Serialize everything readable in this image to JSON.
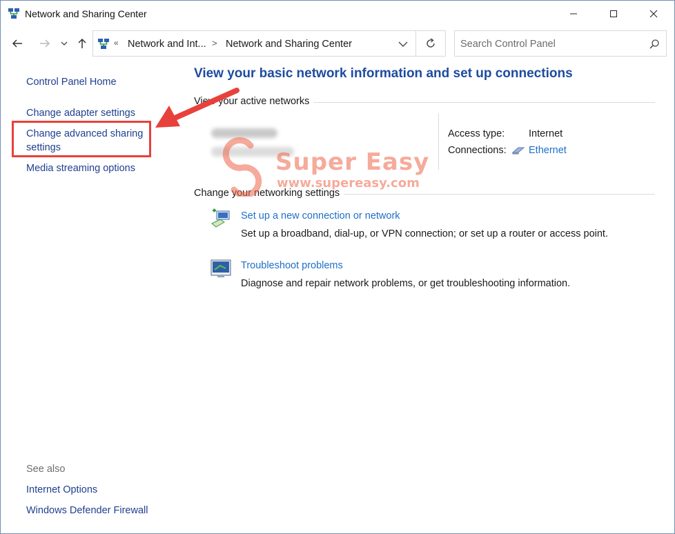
{
  "window": {
    "title": "Network and Sharing Center",
    "controls": {
      "minimize": "minimize",
      "maximize": "maximize",
      "close": "close"
    }
  },
  "navbar": {
    "back_icon": "arrow-left-icon",
    "forward_icon": "arrow-right-icon",
    "recent_icon": "chevron-down-icon",
    "up_icon": "arrow-up-icon",
    "breadcrumb": {
      "overflow": "«",
      "items": [
        "Network and Int...",
        "Network and Sharing Center"
      ],
      "separator": ">"
    },
    "refresh_icon": "refresh-icon",
    "search": {
      "placeholder": "Search Control Panel",
      "value": ""
    }
  },
  "sidebar": {
    "home": "Control Panel Home",
    "links": [
      "Change adapter settings",
      "Change advanced sharing settings",
      "Media streaming options"
    ],
    "see_also_label": "See also",
    "see_also": [
      "Internet Options",
      "Windows Defender Firewall"
    ]
  },
  "main": {
    "title": "View your basic network information and set up connections",
    "active_networks": {
      "heading": "View your active networks",
      "access_type_label": "Access type:",
      "access_type_value": "Internet",
      "connections_label": "Connections:",
      "connections_value": "Ethernet"
    },
    "change_settings": {
      "heading": "Change your networking settings",
      "tasks": [
        {
          "icon": "network-setup-icon",
          "title": "Set up a new connection or network",
          "description": "Set up a broadband, dial-up, or VPN connection; or set up a router or access point."
        },
        {
          "icon": "troubleshoot-icon",
          "title": "Troubleshoot problems",
          "description": "Diagnose and repair network problems, or get troubleshooting information."
        }
      ]
    }
  },
  "annotation": {
    "highlight_color": "#e8413b",
    "arrow_color": "#e8413b"
  },
  "watermark": {
    "brand": "Super Easy",
    "url": "www.supereasy.com"
  },
  "colors": {
    "link": "#1e6fc8",
    "sidebar_link": "#1e3f8f",
    "title": "#1e4ba0"
  }
}
